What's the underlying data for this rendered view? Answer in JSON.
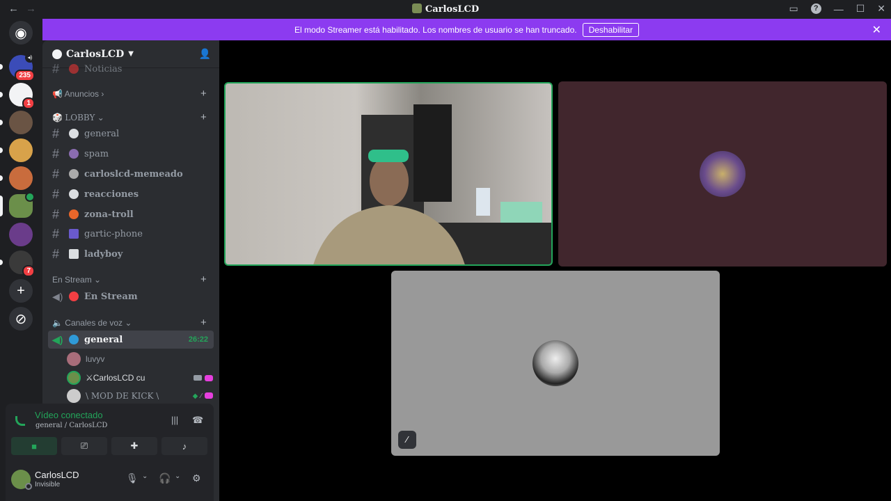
{
  "window": {
    "title": "CarlosLCD",
    "back": "←",
    "forward": "→"
  },
  "banner": {
    "message": "El modo Streamer está habilitado. Los nombres de usuario se han truncado.",
    "button": "Deshabilitar"
  },
  "guilds": [
    {
      "badge": "235"
    },
    {
      "badge": "1"
    },
    {
      "badge": ""
    },
    {
      "badge": ""
    },
    {
      "badge": ""
    },
    {
      "badge": ""
    },
    {
      "badge": ""
    },
    {
      "badge": "7"
    }
  ],
  "server": {
    "name": "CarlosLCD"
  },
  "categories": {
    "top_partial": "Noticias",
    "anuncios": "Anuncios",
    "lobby": "LOBBY",
    "stream": "En Stream",
    "voice": "Canales de voz"
  },
  "channels": {
    "lobby": [
      {
        "name": "general"
      },
      {
        "name": "spam"
      },
      {
        "name": "carloslcd-memeado"
      },
      {
        "name": "reacciones"
      },
      {
        "name": "zona-troll"
      },
      {
        "name": "gartic-phone"
      },
      {
        "name": "ladyboy"
      }
    ],
    "stream": {
      "name": "En Stream"
    },
    "voice": {
      "name": "general",
      "timer": "26:22"
    }
  },
  "voice_users": [
    {
      "name": "luvyv"
    },
    {
      "name": "⚔CarlosLCD cu"
    },
    {
      "name": "\\ MOD DE KICK \\"
    }
  ],
  "voice_panel": {
    "title": "Vídeo conectado",
    "subtitle": "general / CarlosLCD"
  },
  "user_panel": {
    "name": "CarlosLCD",
    "status": "Invisible"
  },
  "colors": {
    "accent": "#8c3bf0",
    "green": "#23a55a",
    "red": "#f23f43"
  }
}
